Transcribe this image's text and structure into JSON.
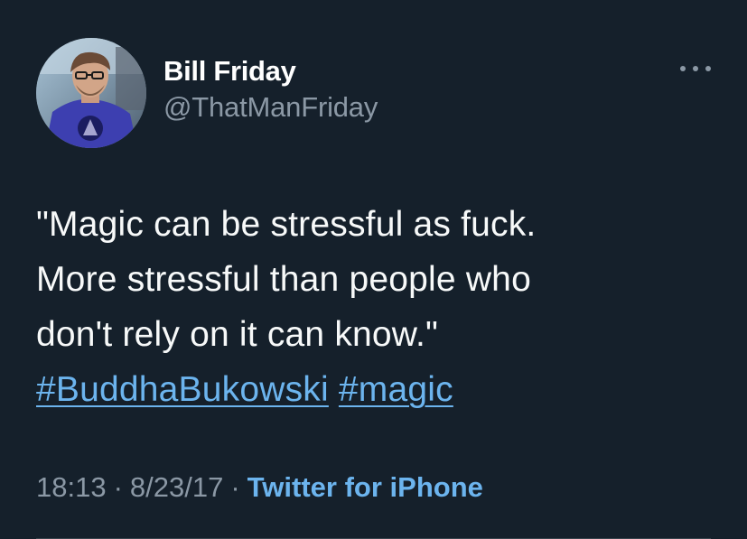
{
  "author": {
    "display_name": "Bill Friday",
    "handle": "@ThatManFriday"
  },
  "tweet": {
    "lines": [
      "\"Magic can be stressful as fuck.",
      "More stressful than people who",
      "don't rely on it can know.\""
    ],
    "hashtags": [
      "#BuddhaBukowski",
      "#magic"
    ]
  },
  "meta": {
    "time": "18:13",
    "separator": "·",
    "date": "8/23/17",
    "source": "Twitter for iPhone"
  },
  "icons": {
    "avatar": "profile-photo",
    "more": "more-horizontal-icon"
  },
  "colors": {
    "background": "#15202b",
    "text": "#f7f9f9",
    "secondary": "#8b98a5",
    "link": "#6cb4ee"
  }
}
